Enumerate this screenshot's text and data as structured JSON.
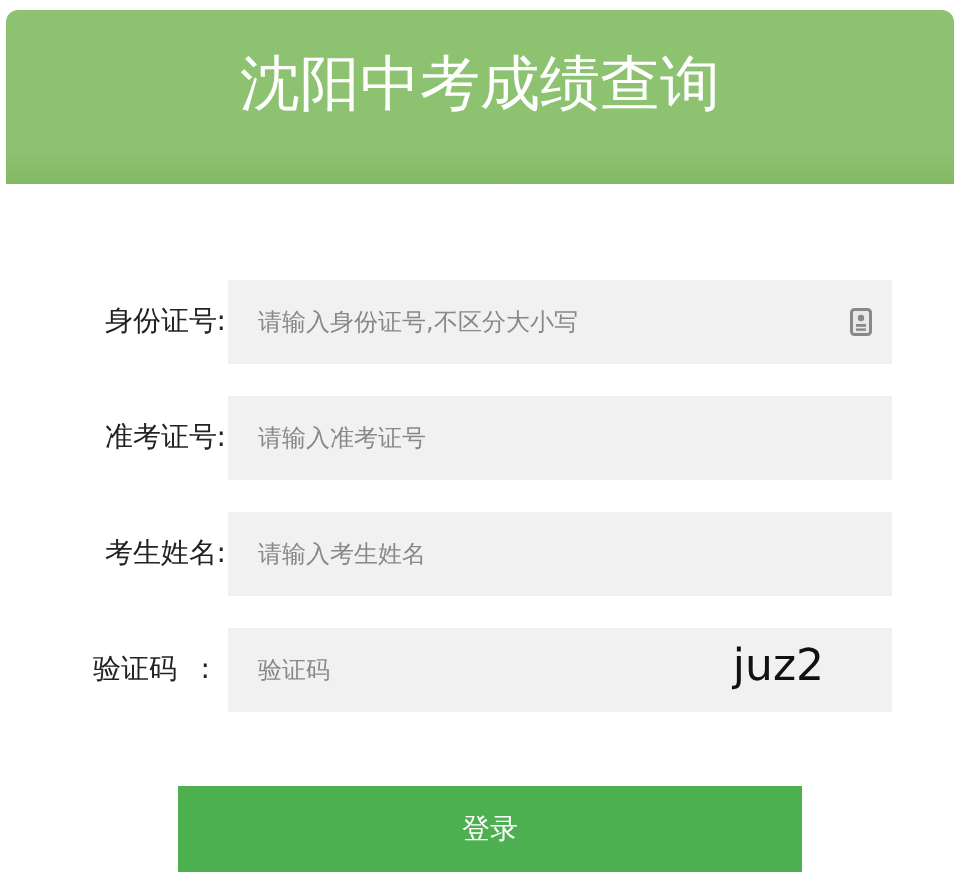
{
  "header": {
    "title": "沈阳中考成绩查询"
  },
  "fields": [
    {
      "kind": "id",
      "label": "身份证号:",
      "placeholder": "请输入身份证号,不区分大小写"
    },
    {
      "kind": "text",
      "label": "准考证号:",
      "placeholder": "请输入准考证号"
    },
    {
      "kind": "text",
      "label": "考生姓名:",
      "placeholder": "请输入考生姓名"
    },
    {
      "kind": "captcha",
      "label": "验证码",
      "colon": ":",
      "placeholder": "验证码",
      "code": "juz2"
    }
  ],
  "button": "登录"
}
